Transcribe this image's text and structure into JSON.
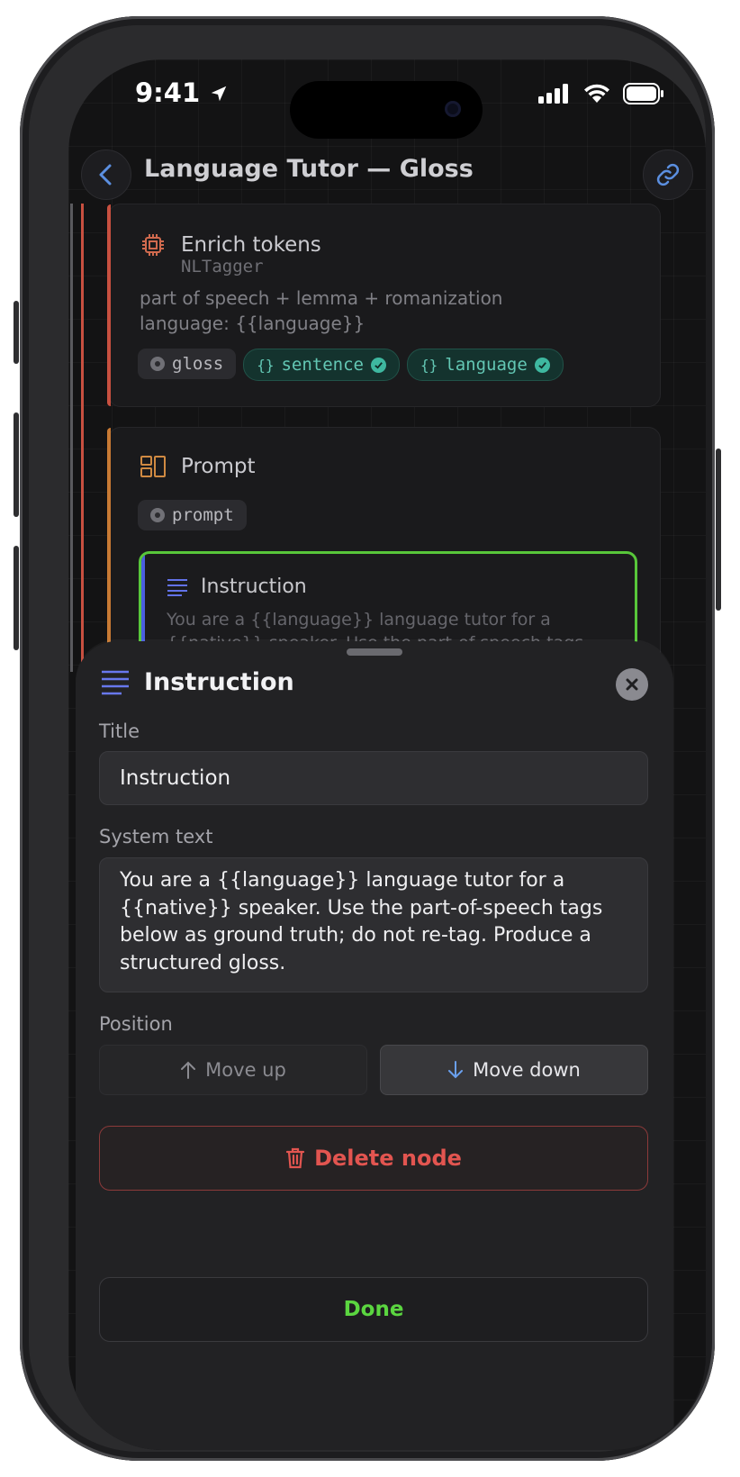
{
  "status_bar": {
    "time": "9:41"
  },
  "nav": {
    "title": "Language Tutor — Gloss"
  },
  "colors": {
    "accent_green": "#5bd640",
    "delete_red": "#e25550",
    "teal": "#63c7b4",
    "rail_red": "#c85040",
    "rail_orange": "#c87a34"
  },
  "cards": {
    "enrich": {
      "icon": "cpu-chip-icon",
      "title": "Enrich tokens",
      "subtitle": "NLTagger",
      "line1": "part of speech + lemma + romanization",
      "line2": "language: {{language}}",
      "chips": [
        "gloss",
        "sentence",
        "language"
      ]
    },
    "prompt": {
      "icon": "layout-blocks-icon",
      "title": "Prompt",
      "chip": "prompt",
      "instruction": {
        "title": "Instruction",
        "preview_line1": "You are a {{language}} language tutor for a",
        "preview_line2": "{{native}} speaker. Use the part-of-speech tags"
      }
    }
  },
  "sheet": {
    "title": "Instruction",
    "title_label": "Title",
    "title_value": "Instruction",
    "system_label": "System text",
    "system_lines": [
      "You are a {{language}} language tutor for a",
      "{{native}} speaker. Use the part-of-speech tags",
      "below as ground truth; do not re-tag. Produce a",
      "structured gloss."
    ],
    "position_label": "Position",
    "move_up": "Move up",
    "move_down": "Move down",
    "delete": "Delete node",
    "done": "Done"
  }
}
